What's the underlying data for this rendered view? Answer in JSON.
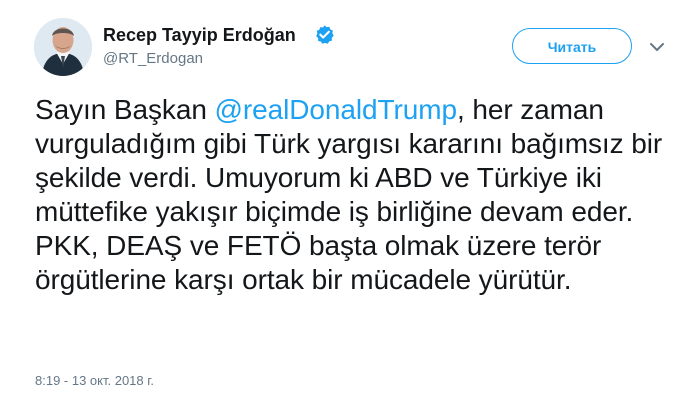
{
  "tweet": {
    "author": {
      "name": "Recep Tayyip Erdoğan",
      "handle": "@RT_Erdogan",
      "avatar_icon": "profile-photo",
      "verified_icon": "verified-badge-icon"
    },
    "follow_button_label": "Читать",
    "more_options_icon": "chevron-down-icon",
    "text_segments": {
      "before_mention": "Sayın Başkan ",
      "mention": "@realDonaldTrump",
      "after_mention": ", her zaman vurguladığım gibi Türk yargısı kararını bağımsız bir şekilde verdi. Umuyorum ki ABD ve Türkiye iki müttefike yakışır biçimde iş birliğine devam eder. PKK, DEAŞ ve FETÖ başta olmak üzere terör örgütlerine karşı ortak bir mücadele yürütür."
    },
    "timestamp": "8:19 - 13 окт. 2018 г."
  },
  "colors": {
    "accent": "#1da1f2",
    "text_primary": "#14171a",
    "text_secondary": "#657786"
  }
}
